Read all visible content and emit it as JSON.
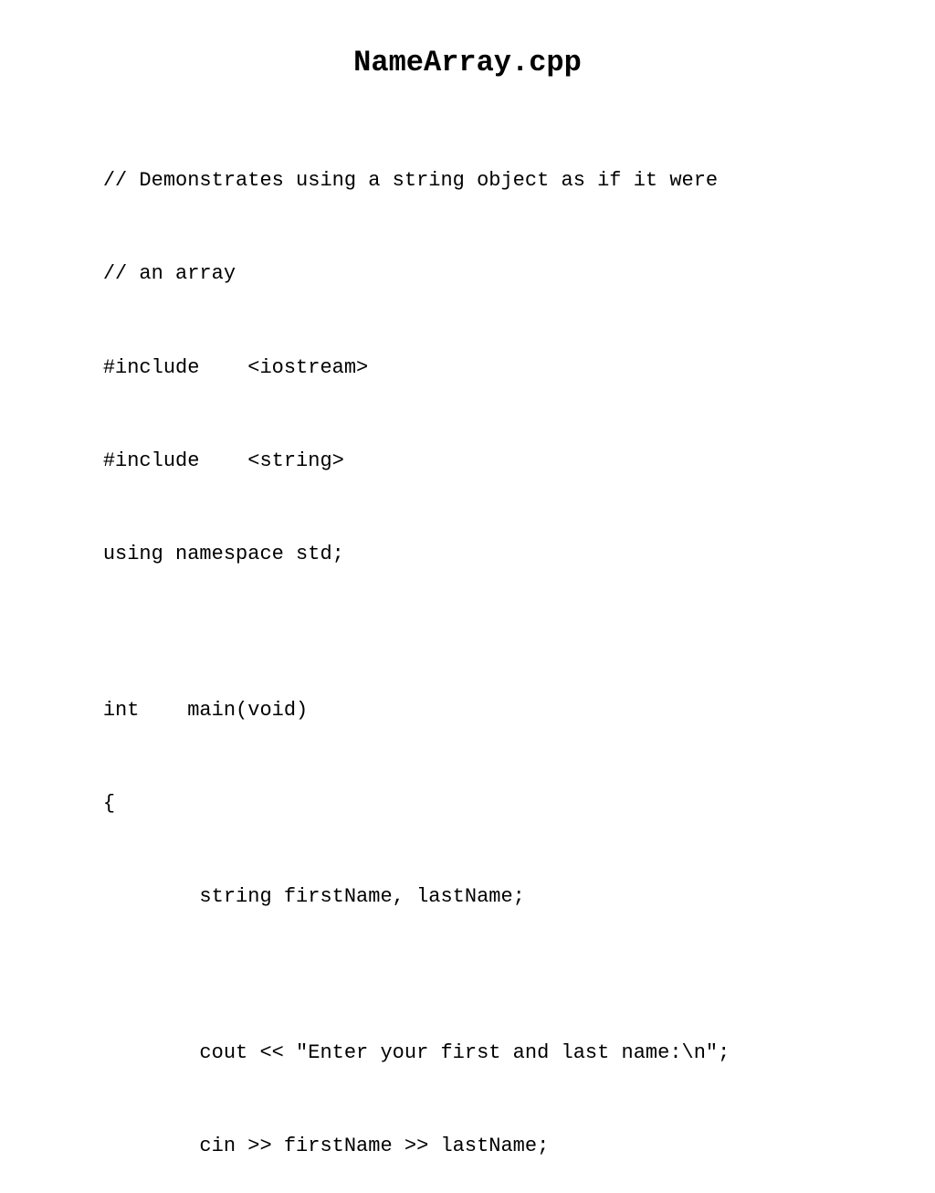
{
  "title": "NameArray.cpp",
  "code": {
    "line1": "// Demonstrates using a string object as if it were",
    "line2": "// an array",
    "line3": "#include    <iostream>",
    "line4": "#include    <string>",
    "line5": "using namespace std;",
    "line6": "",
    "line7": "int    main(void)",
    "line8": "{",
    "line9": "        string firstName, lastName;",
    "line10": "",
    "line11": "        cout << \"Enter your first and last name:\\n\";",
    "line12": "        cin >> firstName >> lastName;"
  }
}
